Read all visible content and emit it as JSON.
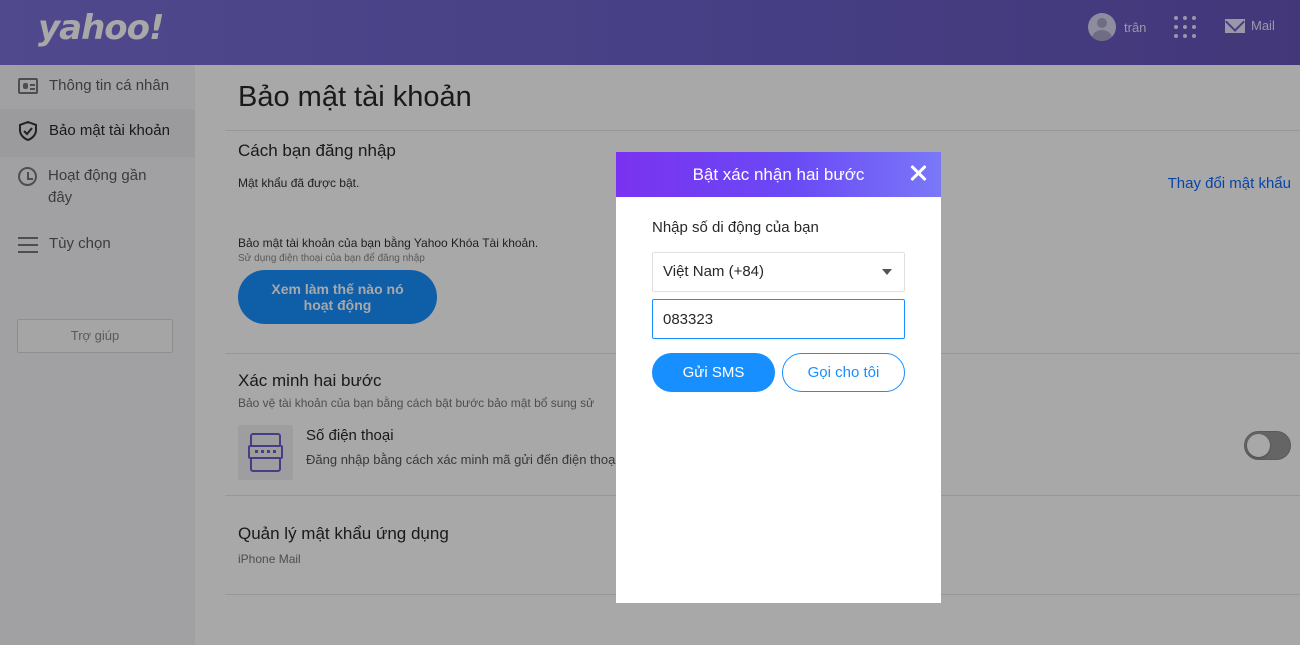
{
  "header": {
    "logo": "yahoo!",
    "username": "trân",
    "mail_label": "Mail"
  },
  "sidebar": {
    "items": [
      {
        "label": "Thông tin cá nhân",
        "icon": "profile-card-icon"
      },
      {
        "label": "Bảo mật tài khoản",
        "icon": "shield-icon",
        "active": true
      },
      {
        "label": "Hoạt động gần đây",
        "icon": "clock-icon"
      },
      {
        "label": "Tùy chọn",
        "icon": "list-icon"
      }
    ],
    "help_label": "Trợ giúp"
  },
  "main": {
    "title": "Bảo mật tài khoản",
    "signin": {
      "title": "Cách bạn đăng nhập",
      "password_status": "Mật khẩu đã được bật.",
      "change_password_link": "Thay đổi mật khẩu",
      "account_key_text": "Bảo mật tài khoản của bạn bằng Yahoo Khóa Tài khoản.",
      "account_key_sub": "Sử dụng điện thoại của bạn để đăng nhập",
      "how_it_works_button": "Xem làm thế nào nó hoạt động"
    },
    "two_step": {
      "title": "Xác minh hai bước",
      "desc": "Bảo vệ tài khoản của bạn bằng cách bật bước bảo mật bổ sung sử",
      "phone_title": "Số điện thoại",
      "phone_desc": "Đăng nhập bằng cách xác minh mã gửi đến điện thoại c",
      "toggle_on": false
    },
    "app_passwords": {
      "title": "Quản lý mật khẩu ứng dụng",
      "sub": "iPhone Mail"
    }
  },
  "modal": {
    "title": "Bật xác nhận hai bước",
    "label": "Nhập số di động của bạn",
    "country_value": "Việt Nam (+84)",
    "phone_value": "083323",
    "sms_button": "Gửi SMS",
    "call_button": "Gọi cho tôi"
  },
  "colors": {
    "header_bg": "#6b5fc9",
    "modal_header": "#7a32f0",
    "primary_blue": "#188fff",
    "link_blue": "#0f69ff"
  }
}
